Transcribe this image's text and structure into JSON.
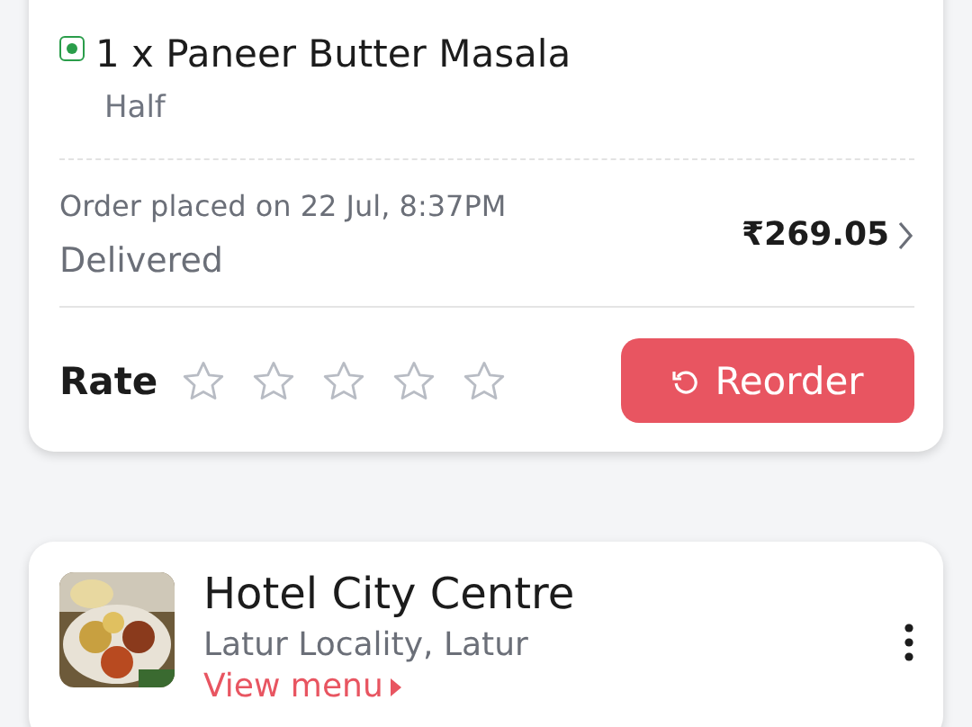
{
  "order": {
    "veg": true,
    "item": "1 x Paneer Butter Masala",
    "variant": "Half",
    "placed": "Order placed on 22 Jul, 8:37PM",
    "status": "Delivered",
    "total": "₹269.05",
    "rate_label": "Rate",
    "stars": 0,
    "reorder": "Reorder"
  },
  "restaurant": {
    "name": "Hotel City Centre",
    "locality": "Latur Locality, Latur",
    "link": "View menu"
  }
}
